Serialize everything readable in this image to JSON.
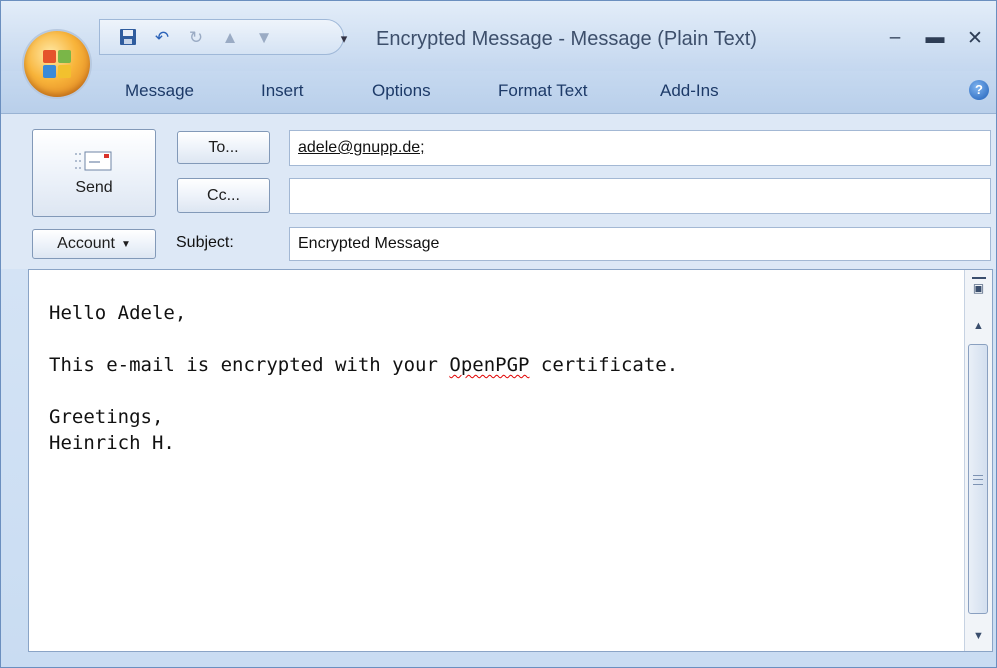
{
  "window": {
    "title": "Encrypted Message - Message (Plain Text)"
  },
  "quick_access": [
    "save-icon",
    "undo-icon",
    "redo-icon",
    "up-arrow-icon",
    "down-arrow-icon"
  ],
  "ribbon": {
    "tabs": [
      "Message",
      "Insert",
      "Options",
      "Format Text",
      "Add-Ins"
    ]
  },
  "header": {
    "send_label": "Send",
    "to_label": "To...",
    "cc_label": "Cc...",
    "account_label": "Account",
    "subject_label": "Subject:",
    "to_value": "adele@gnupp.de;",
    "cc_value": "",
    "subject_value": "Encrypted Message"
  },
  "body": {
    "line1": "Hello Adele,",
    "line2_pre": "This e-mail is encrypted with your ",
    "line2_word": "OpenPGP",
    "line2_post": " certificate.",
    "line3": "Greetings,",
    "line4": "Heinrich H."
  },
  "colors": {
    "accent": "#1d3a68",
    "spell_error": "#e00000",
    "orb": "#f8b43a"
  }
}
